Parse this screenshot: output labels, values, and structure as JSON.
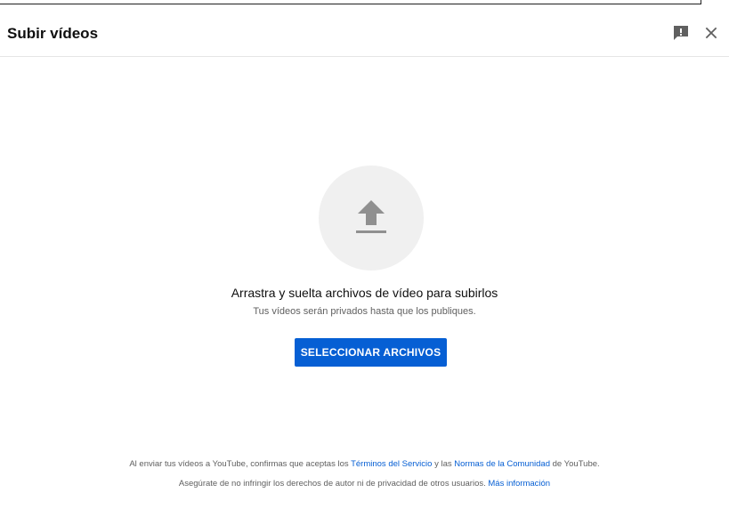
{
  "dialog": {
    "title": "Subir vídeos"
  },
  "header_icons": {
    "feedback": "feedback-icon",
    "close": "close-icon"
  },
  "upload": {
    "icon": "upload-arrow-icon",
    "drop_text": "Arrastra y suelta archivos de vídeo para subirlos",
    "privacy_text": "Tus vídeos serán privados hasta que los publiques.",
    "select_button": "SELECCIONAR ARCHIVOS"
  },
  "legal": {
    "line1_prefix": "Al enviar tus vídeos a YouTube, confirmas que aceptas los",
    "terms_link": "Términos del Servicio",
    "line1_middle": "y las",
    "community_link": "Normas de la Comunidad",
    "line1_suffix": "de YouTube.",
    "line2_text": "Asegúrate de no infringir los derechos de autor ni de privacidad de otros usuarios.",
    "more_info_link": "Más información"
  },
  "colors": {
    "accent": "#065fd4",
    "text_primary": "#0f0f0f",
    "text_secondary": "#606060",
    "circle_bg": "#f0f0f0",
    "icon_gray": "#909090"
  }
}
